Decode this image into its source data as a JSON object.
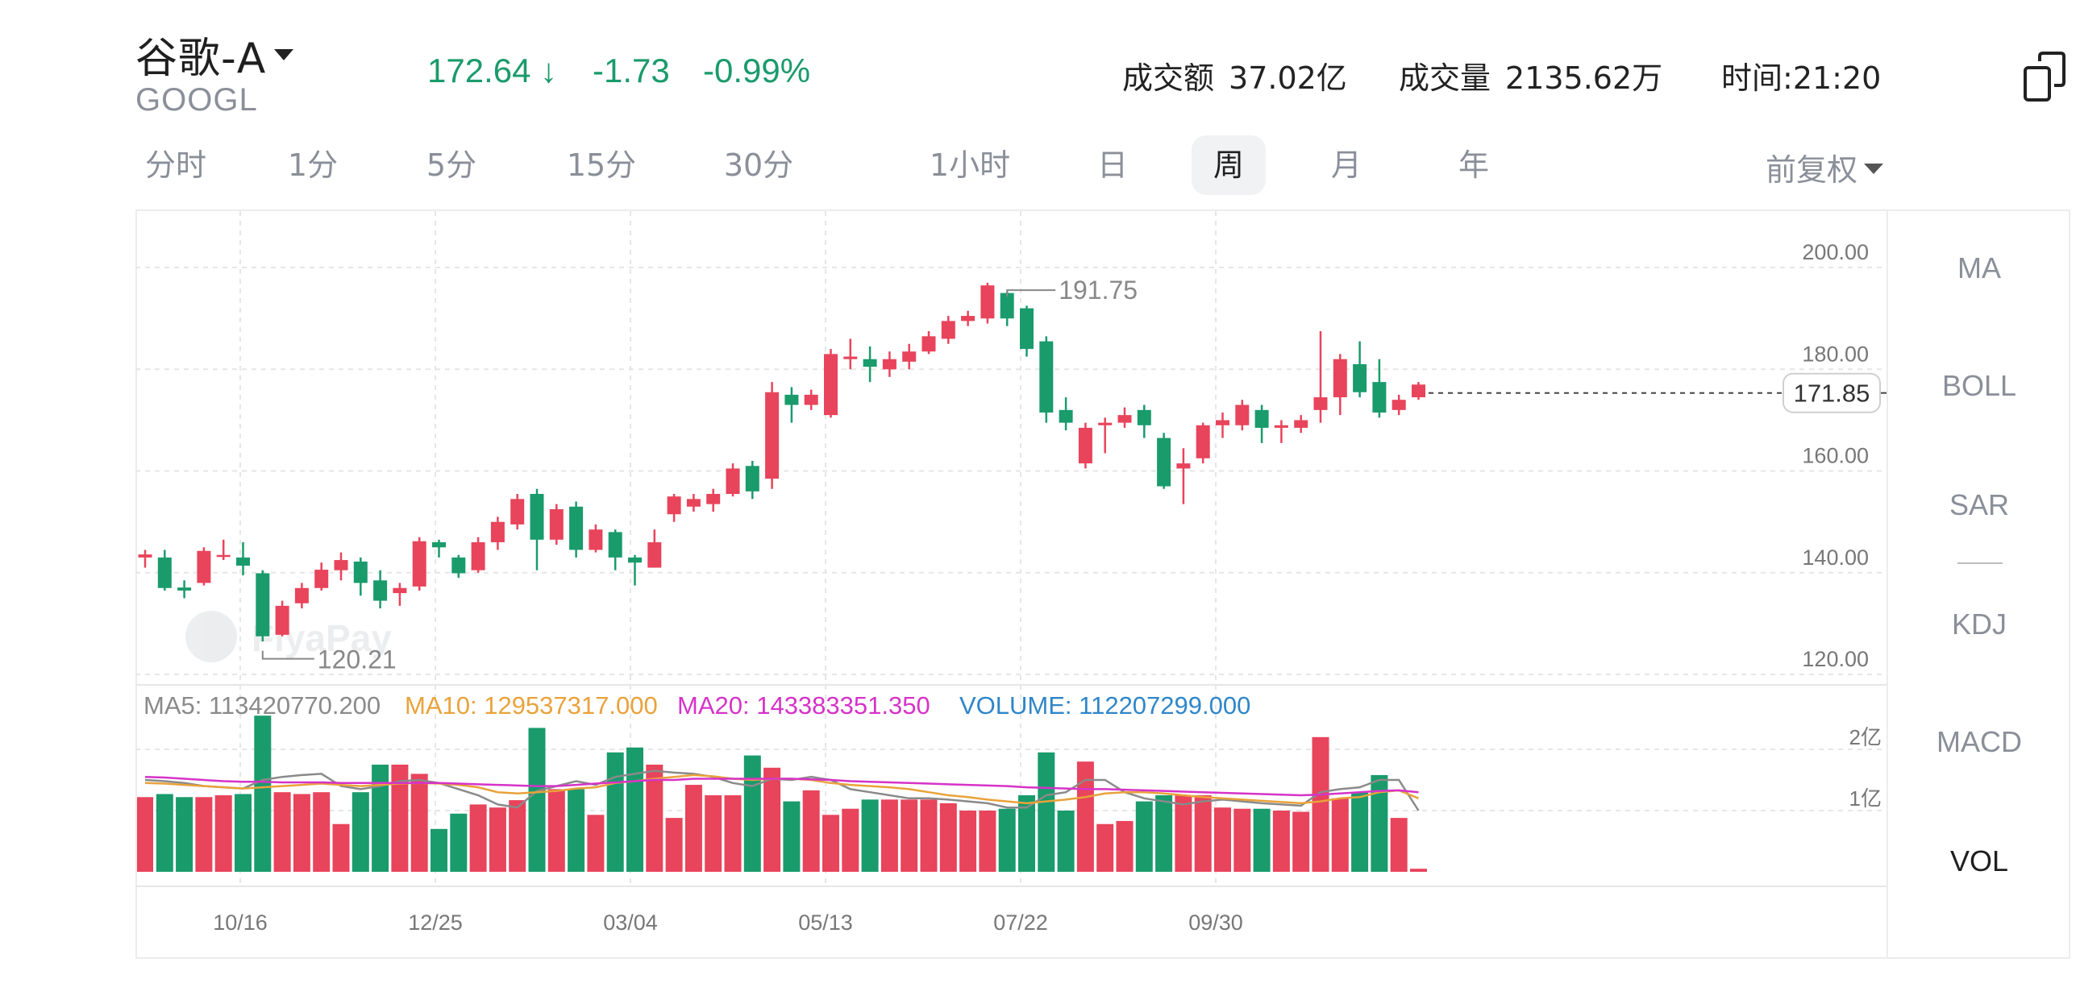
{
  "header": {
    "name": "谷歌-A",
    "ticker": "GOOGL",
    "price": "172.64",
    "arrow": "↓",
    "change": "-1.73",
    "change_pct": "-0.99%",
    "turnover_label": "成交额",
    "turnover_value": "37.02亿",
    "volume_label": "成交量",
    "volume_value": "2135.62万",
    "time_label": "时间:",
    "time_value": "21:20",
    "down_color": "#1a9b6c"
  },
  "tabs": [
    "分时",
    "1分",
    "5分",
    "15分",
    "30分",
    "1小时",
    "日",
    "周",
    "月",
    "年"
  ],
  "active_tab": "周",
  "adjust_label": "前复权",
  "indicators": [
    "MA",
    "BOLL",
    "SAR",
    "KDJ",
    "MACD",
    "VOL"
  ],
  "active_indicator": "VOL",
  "watermark": "FlyaPay",
  "chart_data": {
    "type": "candlestick",
    "up_color": "#e8445b",
    "down_color": "#1a9b6c",
    "y_ticks": [
      "200.00",
      "180.00",
      "160.00",
      "140.00",
      "120.00"
    ],
    "x_ticks": [
      "10/16",
      "12/25",
      "03/04",
      "05/13",
      "07/22",
      "09/30"
    ],
    "high_label": "191.75",
    "low_label": "120.21",
    "last_price_label": "171.85",
    "vol_ticks": [
      "2亿",
      "1亿"
    ],
    "legend": {
      "ma5": "MA5: 113420770.200",
      "ma10": "MA10: 129537317.000",
      "ma20": "MA20: 143383351.350",
      "volume": "VOLUME: 112207299.000"
    },
    "legend_colors": {
      "ma5": "#8a8a8a",
      "ma10": "#e9a23b",
      "ma20": "#d633c8",
      "volume": "#2f86c9"
    },
    "candles": [
      [
        139.5,
        140.1,
        141,
        137.5
      ],
      [
        139.5,
        133.5,
        141,
        133
      ],
      [
        133.6,
        133,
        135,
        131.5
      ],
      [
        134.5,
        140.8,
        141.5,
        134
      ],
      [
        140,
        140,
        143,
        139
      ],
      [
        139.5,
        137.9,
        142.5,
        136
      ],
      [
        136.4,
        124,
        137,
        123
      ],
      [
        124.3,
        130,
        131,
        124
      ],
      [
        130.5,
        133.5,
        134.5,
        129.5
      ],
      [
        133.5,
        137.1,
        138.5,
        133
      ],
      [
        137,
        139,
        140.5,
        135
      ],
      [
        138.7,
        134.5,
        139.5,
        132
      ],
      [
        135,
        131,
        137,
        129.5
      ],
      [
        132.5,
        133.5,
        134.5,
        130
      ],
      [
        133.8,
        142.7,
        143.5,
        133
      ],
      [
        142.5,
        141.5,
        143,
        139.5
      ],
      [
        139.5,
        136.4,
        140,
        135.5
      ],
      [
        137,
        142.5,
        143.5,
        136.5
      ],
      [
        142.5,
        146.5,
        147.5,
        141
      ],
      [
        146,
        151,
        152,
        145
      ],
      [
        152,
        143,
        153,
        137
      ],
      [
        143,
        149,
        150,
        142
      ],
      [
        149.5,
        141,
        150.5,
        139.5
      ],
      [
        141,
        145,
        146,
        140.5
      ],
      [
        144.5,
        139.5,
        145,
        137
      ],
      [
        139.5,
        138.5,
        140,
        134
      ],
      [
        137.5,
        142.5,
        145,
        137.5
      ],
      [
        148,
        151.5,
        152,
        146.5
      ],
      [
        149.5,
        151,
        152,
        148.5
      ],
      [
        150,
        152,
        153,
        148.5
      ],
      [
        152,
        157,
        158,
        151.5
      ],
      [
        157.5,
        152.5,
        158.5,
        151
      ],
      [
        155,
        172,
        174,
        153
      ],
      [
        171.5,
        169.5,
        173,
        166
      ],
      [
        169.5,
        171.5,
        172.5,
        168.5
      ],
      [
        167.5,
        179.5,
        180.5,
        167
      ],
      [
        178.5,
        179,
        182.5,
        176.5
      ],
      [
        178.5,
        177,
        181,
        174
      ],
      [
        176.5,
        178.5,
        180,
        175
      ],
      [
        178,
        180,
        181.5,
        176.5
      ],
      [
        180,
        183,
        184,
        179.5
      ],
      [
        182.5,
        186,
        187,
        181.5
      ],
      [
        186,
        187,
        188,
        185
      ],
      [
        186.5,
        193,
        193.5,
        185.5
      ],
      [
        191.5,
        186.5,
        191.75,
        185
      ],
      [
        188.5,
        180.5,
        189,
        179
      ],
      [
        182,
        168,
        183,
        166
      ],
      [
        168.5,
        166,
        171,
        164.5
      ],
      [
        158,
        165,
        166,
        157
      ],
      [
        165.5,
        166,
        167,
        160
      ],
      [
        166,
        167.5,
        169,
        165
      ],
      [
        168.5,
        165.5,
        169.5,
        163
      ],
      [
        163,
        153.5,
        164,
        153
      ],
      [
        157,
        158,
        161,
        150
      ],
      [
        159,
        165.5,
        166,
        158
      ],
      [
        165.5,
        166.5,
        168,
        163
      ],
      [
        165.5,
        169.5,
        170.5,
        164.5
      ],
      [
        168.5,
        165,
        169.5,
        162
      ],
      [
        165,
        165.5,
        166.5,
        162
      ],
      [
        165,
        166.5,
        167.5,
        164
      ],
      [
        168.5,
        171,
        184,
        166
      ],
      [
        171,
        178.5,
        179.5,
        167.5
      ],
      [
        177.5,
        172,
        182,
        171
      ],
      [
        174,
        168,
        178.5,
        167
      ],
      [
        168.5,
        170.5,
        171.5,
        167.5
      ],
      [
        171,
        173.5,
        174,
        170.5
      ]
    ],
    "volumes": [
      1.22,
      1.27,
      1.22,
      1.22,
      1.25,
      1.27,
      2.55,
      1.3,
      1.27,
      1.3,
      0.78,
      1.3,
      1.75,
      1.75,
      1.6,
      0.7,
      0.95,
      1.1,
      1.05,
      1.17,
      2.35,
      1.35,
      1.35,
      0.93,
      1.95,
      2.03,
      1.75,
      0.88,
      1.42,
      1.25,
      1.25,
      1.9,
      1.7,
      1.15,
      1.33,
      0.93,
      1.03,
      1.18,
      1.18,
      1.18,
      1.18,
      1.12,
      1.0,
      1.0,
      1.03,
      1.25,
      1.95,
      1.0,
      1.8,
      0.78,
      0.83,
      1.15,
      1.25,
      1.25,
      1.25,
      1.05,
      1.03,
      1.03,
      1.0,
      0.98,
      2.2,
      1.2,
      1.3,
      1.58,
      0.88,
      0.05
    ],
    "ma5": [
      1.5,
      1.48,
      1.45,
      1.4,
      1.38,
      1.36,
      1.5,
      1.55,
      1.58,
      1.6,
      1.4,
      1.35,
      1.4,
      1.48,
      1.5,
      1.45,
      1.35,
      1.25,
      1.1,
      1.05,
      1.32,
      1.4,
      1.48,
      1.42,
      1.55,
      1.6,
      1.65,
      1.62,
      1.6,
      1.55,
      1.45,
      1.4,
      1.52,
      1.5,
      1.55,
      1.5,
      1.35,
      1.3,
      1.25,
      1.2,
      1.2,
      1.18,
      1.15,
      1.12,
      1.05,
      1.05,
      1.25,
      1.3,
      1.5,
      1.5,
      1.3,
      1.2,
      1.15,
      1.1,
      1.15,
      1.18,
      1.15,
      1.12,
      1.1,
      1.08,
      1.3,
      1.35,
      1.38,
      1.5,
      1.5,
      1.0
    ],
    "ma10": [
      1.45,
      1.44,
      1.42,
      1.4,
      1.38,
      1.36,
      1.38,
      1.4,
      1.42,
      1.44,
      1.42,
      1.4,
      1.42,
      1.44,
      1.45,
      1.44,
      1.42,
      1.38,
      1.3,
      1.28,
      1.3,
      1.32,
      1.36,
      1.38,
      1.45,
      1.48,
      1.52,
      1.55,
      1.58,
      1.56,
      1.52,
      1.5,
      1.52,
      1.52,
      1.5,
      1.45,
      1.42,
      1.4,
      1.38,
      1.35,
      1.3,
      1.25,
      1.22,
      1.18,
      1.15,
      1.12,
      1.15,
      1.18,
      1.22,
      1.28,
      1.3,
      1.3,
      1.28,
      1.25,
      1.22,
      1.2,
      1.18,
      1.16,
      1.14,
      1.12,
      1.15,
      1.2,
      1.22,
      1.3,
      1.33,
      1.2
    ],
    "ma20": [
      1.55,
      1.54,
      1.52,
      1.5,
      1.48,
      1.47,
      1.47,
      1.46,
      1.46,
      1.46,
      1.45,
      1.45,
      1.45,
      1.45,
      1.45,
      1.45,
      1.44,
      1.43,
      1.42,
      1.41,
      1.4,
      1.4,
      1.42,
      1.44,
      1.46,
      1.48,
      1.5,
      1.5,
      1.52,
      1.52,
      1.52,
      1.52,
      1.52,
      1.52,
      1.51,
      1.5,
      1.48,
      1.47,
      1.46,
      1.45,
      1.44,
      1.43,
      1.42,
      1.41,
      1.4,
      1.38,
      1.37,
      1.36,
      1.35,
      1.35,
      1.34,
      1.33,
      1.32,
      1.31,
      1.3,
      1.29,
      1.28,
      1.27,
      1.26,
      1.25,
      1.26,
      1.28,
      1.3,
      1.32,
      1.33,
      1.3
    ]
  }
}
